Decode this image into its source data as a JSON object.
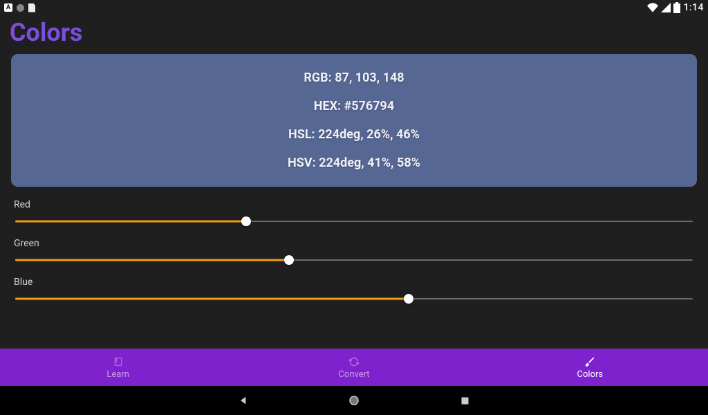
{
  "statusbar": {
    "time": "1:14"
  },
  "title": "Colors",
  "preview": {
    "rgb_label": "RGB: 87, 103, 148",
    "hex_label": "HEX: #576794",
    "hsl_label": "HSL: 224deg, 26%, 46%",
    "hsv_label": "HSV: 224deg, 41%, 58%",
    "bg_color": "#576794"
  },
  "sliders": {
    "red": {
      "label": "Red",
      "value": 87,
      "max": 255
    },
    "green": {
      "label": "Green",
      "value": 103,
      "max": 255
    },
    "blue": {
      "label": "Blue",
      "value": 148,
      "max": 255
    }
  },
  "nav": {
    "learn": {
      "label": "Learn"
    },
    "convert": {
      "label": "Convert"
    },
    "colors": {
      "label": "Colors"
    }
  },
  "colors": {
    "accent": "#7a4fdd",
    "slider": "#f39c12",
    "bottomnav": "#7e22ce"
  }
}
